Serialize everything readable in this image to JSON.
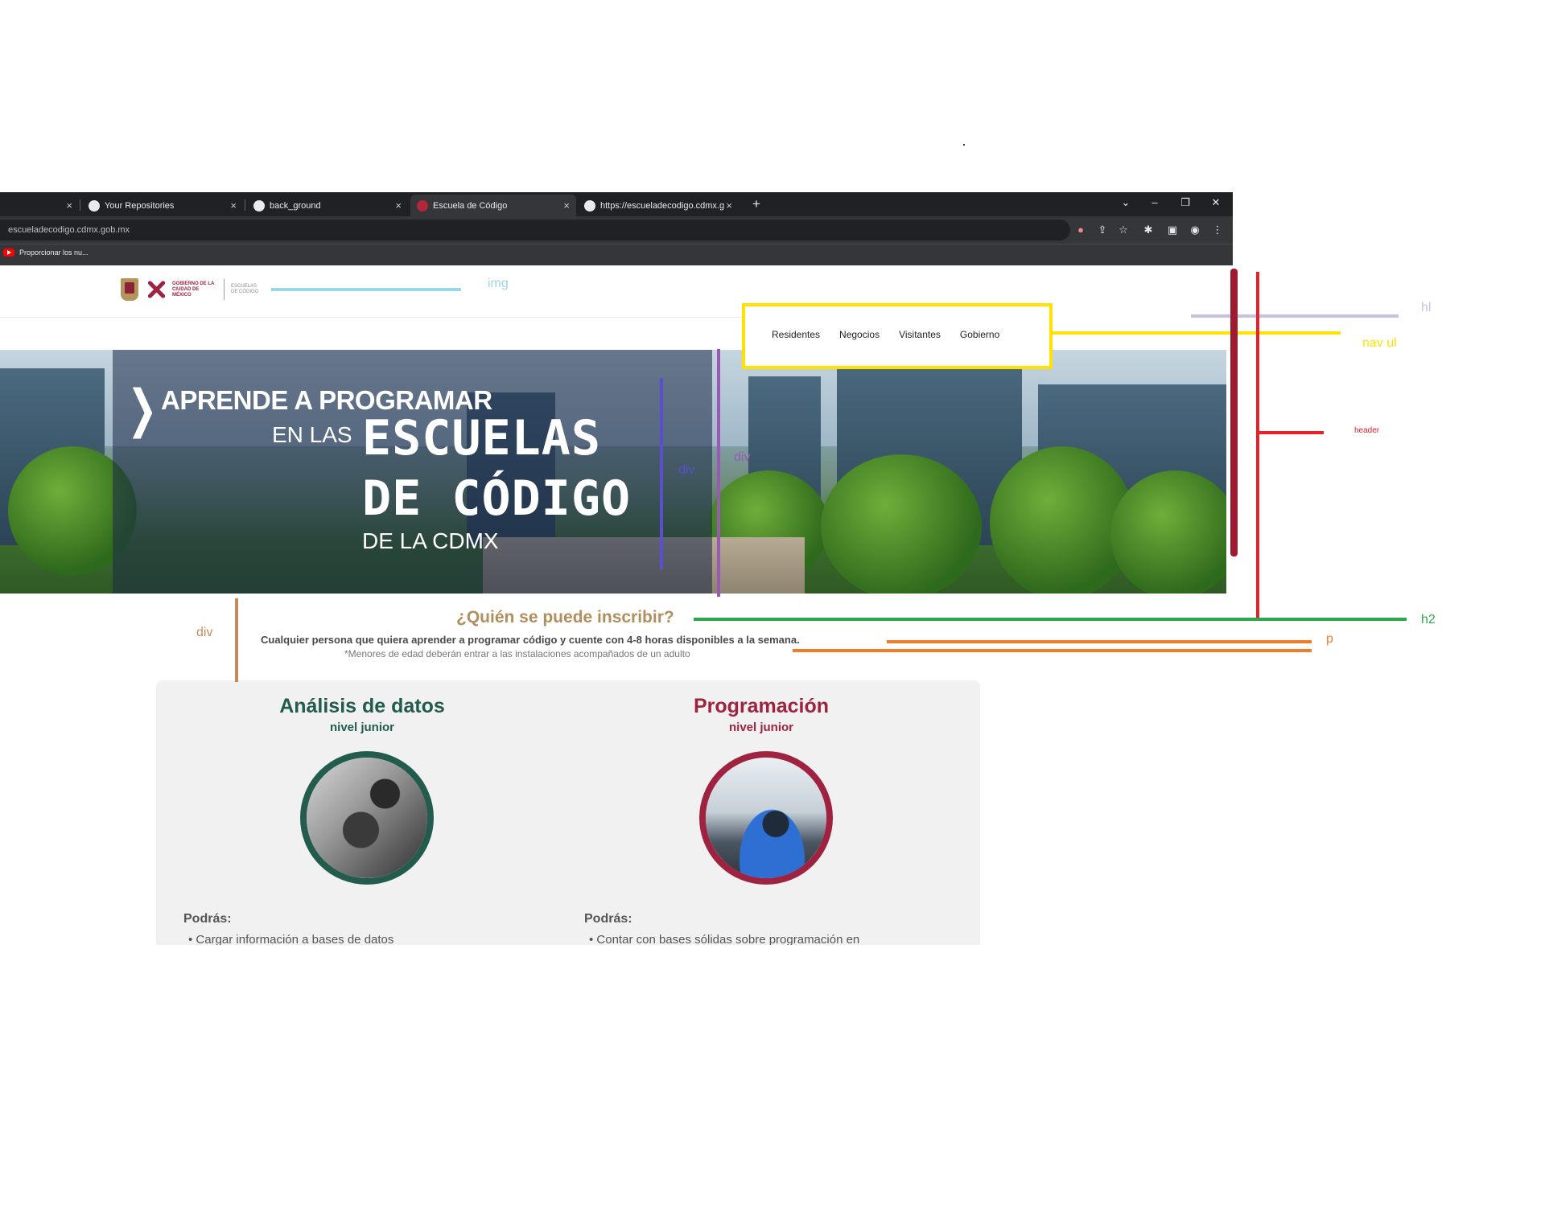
{
  "browser": {
    "tabs": [
      {
        "title": "",
        "close": "×"
      },
      {
        "title": "Your Repositories",
        "close": "×"
      },
      {
        "title": "back_ground",
        "close": "×"
      },
      {
        "title": "Escuela de Código",
        "close": "×"
      },
      {
        "title": "https://escueladecodigo.cdmx.g",
        "close": "×"
      }
    ],
    "new_tab": "+",
    "window_controls": {
      "dropdown": "⌄",
      "minimize": "–",
      "restore": "❐",
      "close": "✕"
    },
    "url": "escueladecodigo.cdmx.gob.mx",
    "bookmark": "Proporcionar los nu...",
    "toolbar_icons": [
      "mic-icon",
      "share-icon",
      "star-icon",
      "extensions-icon",
      "sidepanel-icon",
      "profile-icon",
      "menu-icon"
    ]
  },
  "header": {
    "logo_text": "GOBIERNO DE LA CIUDAD DE MÉXICO",
    "logo_text2": "ESCUELAS DE CÓDIGO",
    "nav": [
      "Residentes",
      "Negocios",
      "Visitantes",
      "Gobierno"
    ]
  },
  "hero": {
    "line1": "APRENDE A PROGRAMAR",
    "line2": "EN LAS",
    "line3": "ESCUELAS",
    "line4": "DE CÓDIGO",
    "line5": "DE LA CDMX"
  },
  "intro": {
    "title": "¿Quién se puede inscribir?",
    "p1": "Cualquier persona que quiera aprender a programar código y cuente con 4-8 horas disponibles a la semana.",
    "p2": "*Menores de edad deberán entrar a las instalaciones acompañados de un adulto"
  },
  "courses": [
    {
      "title": "Análisis de datos",
      "level": "nivel junior",
      "podras": "Podrás:",
      "bullet": "• Cargar información a bases de datos",
      "color": "#235b4e"
    },
    {
      "title": "Programación",
      "level": "nivel junior",
      "podras": "Podrás:",
      "bullet": "• Contar con bases sólidas sobre programación en",
      "color": "#9f2241"
    }
  ],
  "annotations": {
    "img": "img",
    "hl": "hl",
    "nav_ul": "nav ul",
    "header": "header",
    "div_blue": "div",
    "div_purple": "div",
    "h2": "h2",
    "p": "p",
    "div_brown": "div",
    "colors": {
      "img": "#9ad7e6",
      "hl": "#c6c2e6",
      "nav_ul": "#ffe200",
      "header": "#e8202a",
      "div_blue": "#5a4fcf",
      "div_purple": "#9b59b6",
      "h2": "#2aa84a",
      "p": "#f07c2a",
      "div_brown": "#c48a5a"
    }
  }
}
